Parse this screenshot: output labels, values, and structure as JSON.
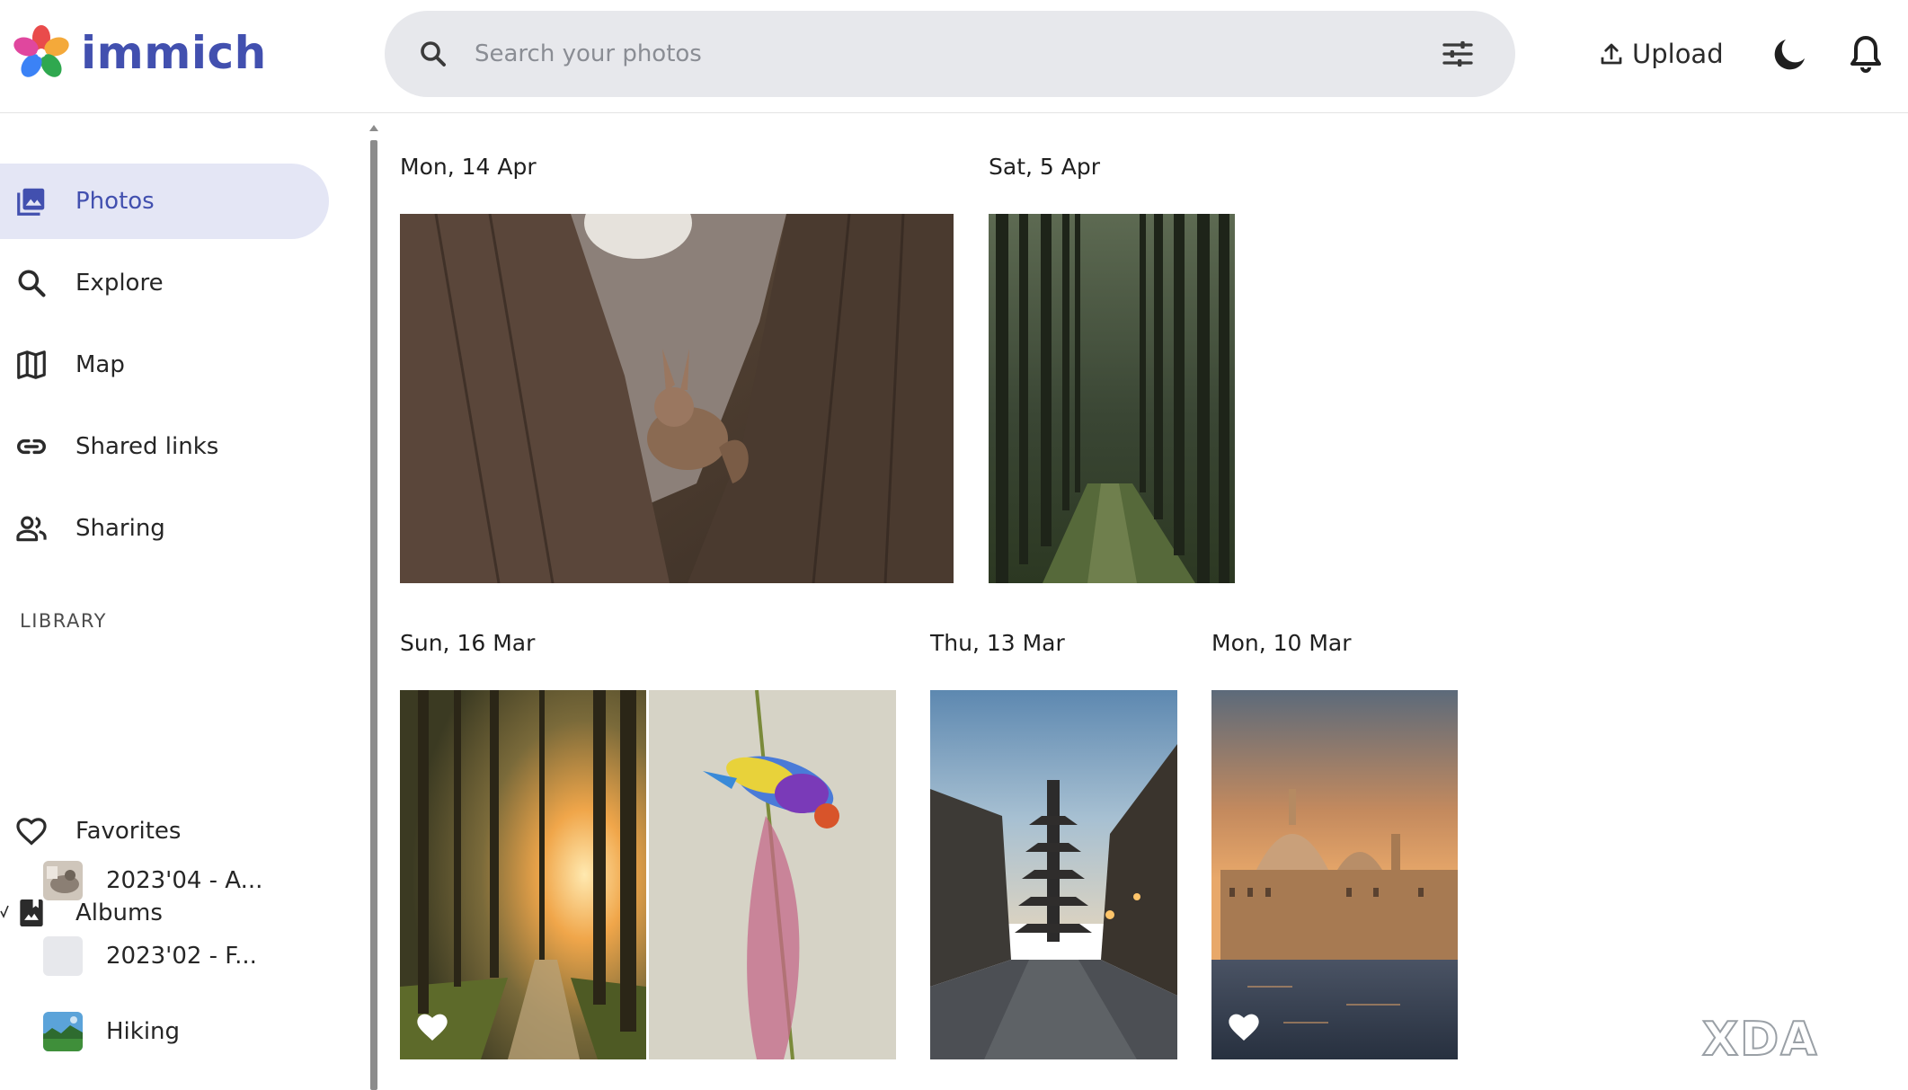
{
  "app": {
    "name": "immich"
  },
  "search": {
    "placeholder": "Search your photos"
  },
  "header": {
    "upload_label": "Upload"
  },
  "sidebar": {
    "items": [
      {
        "label": "Photos",
        "icon": "image-multiple-icon",
        "active": true
      },
      {
        "label": "Explore",
        "icon": "search-icon"
      },
      {
        "label": "Map",
        "icon": "map-icon"
      },
      {
        "label": "Shared links",
        "icon": "link-icon"
      },
      {
        "label": "Sharing",
        "icon": "people-icon"
      }
    ],
    "library_label": "LIBRARY",
    "library_items": [
      {
        "label": "Favorites",
        "icon": "heart-outline-icon"
      },
      {
        "label": "Albums",
        "icon": "album-icon"
      }
    ],
    "albums": [
      {
        "label": "2023'04 - A..."
      },
      {
        "label": "2023'02 - F..."
      },
      {
        "label": "Hiking"
      }
    ]
  },
  "timeline": {
    "groups": [
      {
        "date": "Mon, 14 Apr",
        "photos": [
          {
            "subject": "squirrel-in-tree",
            "favorite": false
          }
        ]
      },
      {
        "date": "Sat, 5 Apr",
        "photos": [
          {
            "subject": "forest-path",
            "favorite": false
          }
        ]
      },
      {
        "date": "Sun, 16 Mar",
        "photos": [
          {
            "subject": "sunlit-forest",
            "favorite": true
          },
          {
            "subject": "colorful-bird",
            "favorite": false
          }
        ]
      },
      {
        "date": "Thu, 13 Mar",
        "photos": [
          {
            "subject": "pagoda-street",
            "favorite": false
          }
        ]
      },
      {
        "date": "Mon, 10 Mar",
        "photos": [
          {
            "subject": "venice-basilica",
            "favorite": true
          }
        ]
      }
    ]
  },
  "watermark": {
    "text": "XDA"
  },
  "colors": {
    "accent": "#4250af",
    "active_bg": "#e4e6f5",
    "search_bg": "#e7e8ec"
  }
}
